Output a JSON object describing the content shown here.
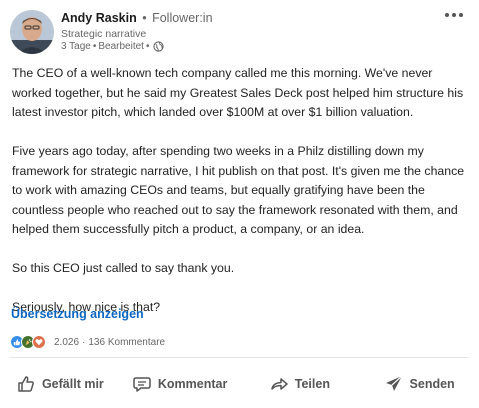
{
  "post": {
    "author": {
      "name": "Andy Raskin",
      "separator": "•",
      "follower_label": "Follower:in",
      "headline": "Strategic narrative",
      "age": "3 Tage",
      "edited": "Bearbeitet",
      "visibility_icon": "globe-icon"
    },
    "more_icon": "ellipsis-icon",
    "body": [
      "The CEO of a well-known tech company called me this morning. We've never worked together, but he said my Greatest Sales Deck post helped him structure his latest investor pitch, which landed over $100M at over $1 billion valuation.",
      "Five years ago today, after spending two weeks in a Philz distilling down my framework for strategic narrative, I hit publish on that post. It's given me the chance to work with amazing CEOs and teams, but equally gratifying have been the countless people who reached out to say the framework resonated with them, and helped them successfully pitch a product, a company, or an idea.",
      "So this CEO just called to say thank you.",
      "Seriously, how nice is that?"
    ],
    "translate_label": "Übersetzung anzeigen",
    "reactions": {
      "icons": [
        "like-icon",
        "celebrate-icon",
        "love-icon"
      ],
      "count": "2.026",
      "separator": "·",
      "comments": "136 Kommentare"
    },
    "actions": {
      "like": "Gefällt mir",
      "comment": "Kommentar",
      "share": "Teilen",
      "send": "Senden"
    }
  },
  "colors": {
    "link": "#0a66c2",
    "like": "#378fe9",
    "celebrate": "#44712e",
    "love": "#df704d"
  }
}
